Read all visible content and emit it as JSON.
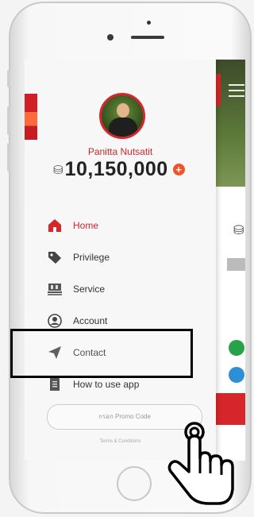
{
  "profile": {
    "name": "Panitta Nutsatit",
    "balance": "10,150,000",
    "add_icon": "plus-icon"
  },
  "menu": [
    {
      "label": "Home",
      "icon": "home-icon",
      "active": true
    },
    {
      "label": "Privilege",
      "icon": "tag-icon",
      "active": false
    },
    {
      "label": "Service",
      "icon": "service-icon",
      "active": false
    },
    {
      "label": "Account",
      "icon": "account-icon",
      "active": false
    },
    {
      "label": "Contact",
      "icon": "send-icon",
      "active": false
    },
    {
      "label": "How to use app",
      "icon": "document-icon",
      "active": false
    }
  ],
  "promo": {
    "placeholder": "กรอก Promo Code"
  },
  "footer": {
    "terms": "Terms & Conditions"
  },
  "colors": {
    "accent": "#d7262b",
    "plus": "#f0542a"
  }
}
